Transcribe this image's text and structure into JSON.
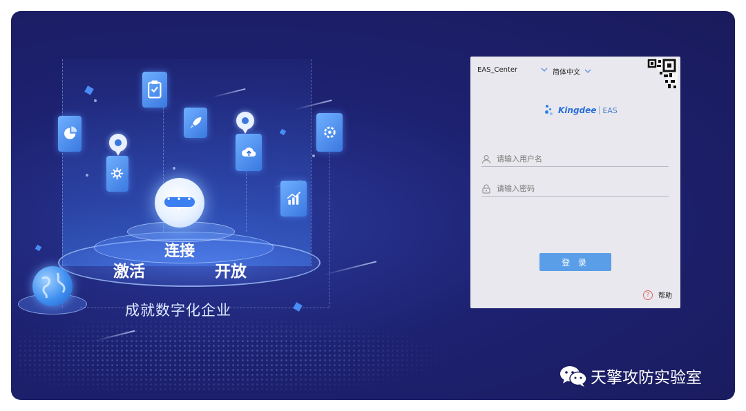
{
  "hero": {
    "tag_connect": "连接",
    "tag_activate": "激活",
    "tag_open": "开放",
    "slogan": "成就数字化企业",
    "orb_dots": "• • • •"
  },
  "login": {
    "server": {
      "value": "EAS_Center"
    },
    "language": {
      "value": "简体中文"
    },
    "brand": {
      "name": "Kingdee",
      "product": "EAS"
    },
    "username": {
      "placeholder": "请输入用户名",
      "value": ""
    },
    "password": {
      "placeholder": "请输入密码",
      "value": ""
    },
    "login_button": "登 录",
    "help": {
      "icon": "?",
      "label": "帮助"
    }
  },
  "watermark": {
    "text": "天擎攻防实验室"
  },
  "icons": {
    "server_dropdown": "chevron-down-icon",
    "language_dropdown": "chevron-down-icon",
    "qr": "qr-code-icon",
    "user": "user-icon",
    "lock": "lock-icon",
    "help": "help-icon",
    "wechat": "wechat-icon"
  },
  "colors": {
    "background": "#1d2170",
    "panel": "#e8e8ee",
    "accent": "#5a9ee8",
    "brand": "#2a6fd8"
  }
}
